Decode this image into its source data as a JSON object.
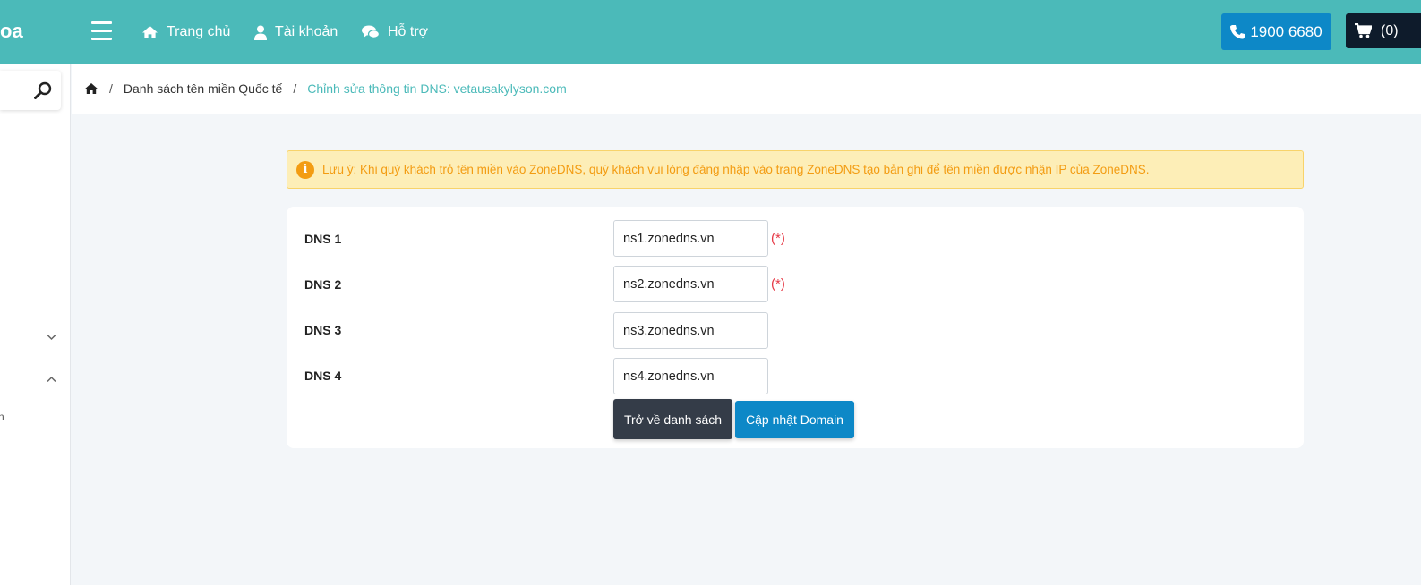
{
  "brand": {
    "text": "oa"
  },
  "nav": {
    "menu_icon": "hamburger-icon",
    "items": [
      {
        "label": "Trang chủ",
        "icon": "home-icon"
      },
      {
        "label": "Tài khoản",
        "icon": "user-icon"
      },
      {
        "label": "Hỗ trợ",
        "icon": "chat-icon"
      }
    ],
    "phone": "1900 6680",
    "cart_count": "(0)"
  },
  "sidebar": {
    "search_icon": "search-icon",
    "partial_text": "n"
  },
  "breadcrumb": {
    "items": [
      "Danh sách tên miền Quốc tế",
      "Chỉnh sửa thông tin DNS: vetausakylyson.com"
    ]
  },
  "alert": {
    "text": "Lưu ý: Khi quý khách trỏ tên miền vào ZoneDNS, quý khách vui lòng đăng nhập vào trang ZoneDNS tạo bản ghi để tên miền được nhận IP của ZoneDNS."
  },
  "form": {
    "rows": [
      {
        "label": "DNS 1",
        "value": "ns1.zonedns.vn",
        "required": "(*)"
      },
      {
        "label": "DNS 2",
        "value": "ns2.zonedns.vn",
        "required": "(*)"
      },
      {
        "label": "DNS 3",
        "value": "ns3.zonedns.vn"
      },
      {
        "label": "DNS 4",
        "value": "ns4.zonedns.vn"
      }
    ],
    "back_label": "Trở về danh sách",
    "update_label": "Cập nhật Domain"
  },
  "colors": {
    "header": "#4bbab9",
    "primary": "#0d88c7",
    "dark": "#343c48",
    "warning": "#f39c12"
  }
}
